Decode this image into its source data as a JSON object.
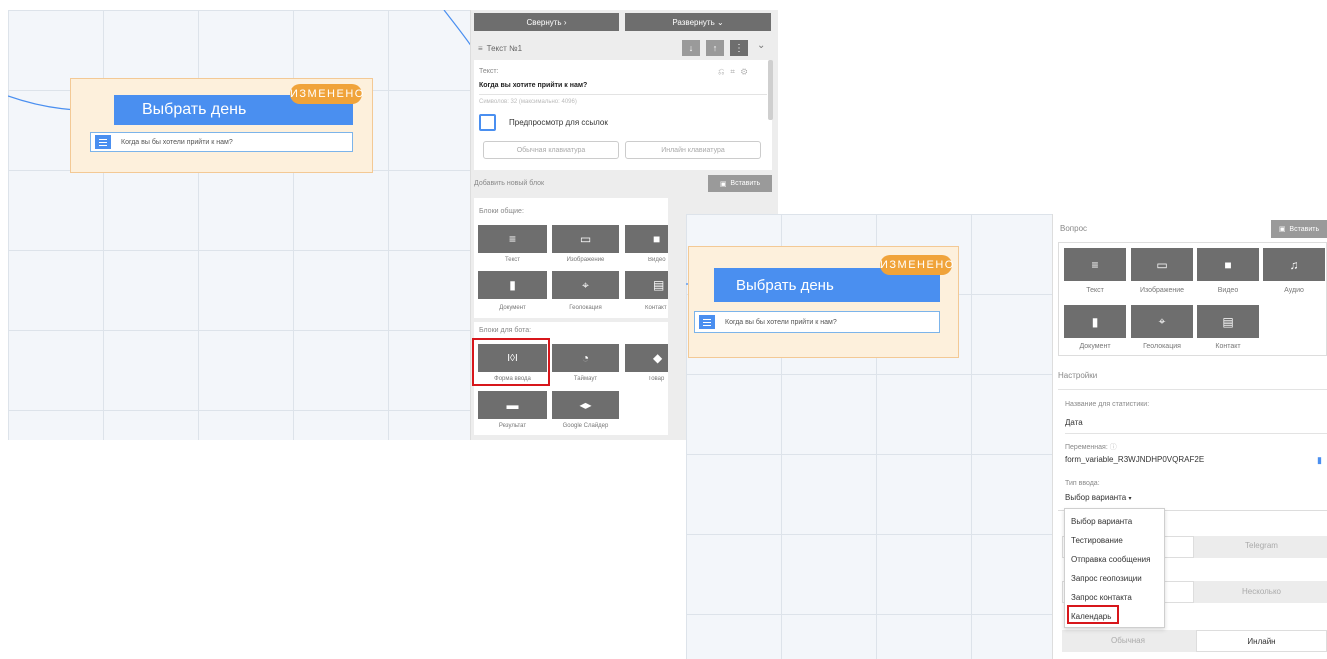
{
  "left": {
    "node": {
      "badge": "ИЗМЕНЕНО",
      "title": "Выбрать день",
      "row_text": "Когда вы бы хотели прийти к нам?"
    },
    "panel": {
      "collapse_label": "Свернуть",
      "expand_label": "Развернуть",
      "block_title": "Текст №1",
      "text_label": "Текст:",
      "text_value": "Когда вы хотите прийти к нам?",
      "symbols_info": "Символов: 32 (максимально: 4096)",
      "preview_label": "Предпросмотр для ссылок",
      "keyboard_normal": "Обычная клавиатура",
      "keyboard_inline": "Инлайн клавиатура",
      "add_block_label": "Добавить новый блок",
      "insert_label": "Вставить",
      "common_blocks_label": "Блоки общие:",
      "common_blocks": [
        "Текст",
        "Изображение",
        "Видео",
        "Документ",
        "Геолокация",
        "Контакт"
      ],
      "bot_blocks_label": "Блоки для бота:",
      "bot_blocks": [
        "Форма ввода",
        "Таймаут",
        "Товар",
        "Результат",
        "Google Слайдер"
      ]
    }
  },
  "right": {
    "node": {
      "badge": "ИЗМЕНЕНО",
      "title": "Выбрать день",
      "row_text": "Когда вы бы хотели прийти к нам?"
    },
    "panel": {
      "question_label": "Вопрос",
      "insert_label": "Вставить",
      "blocks": [
        "Текст",
        "Изображение",
        "Видео",
        "Аудио",
        "Документ",
        "Геолокация",
        "Контакт"
      ],
      "settings_label": "Настройки",
      "stat_name_label": "Название для статистики:",
      "stat_name_value": "Дата",
      "variable_label": "Переменная:",
      "variable_value": "form_variable_R3WJNDHP0VQRAF2E",
      "input_type_label": "Тип ввода:",
      "input_type_value": "Выбор варианта",
      "dropdown_options": [
        "Выбор варианта",
        "Тестирование",
        "Отправка сообщения",
        "Запрос геопозиции",
        "Запрос контакта",
        "Календарь"
      ],
      "telegram_label": "Telegram",
      "multiple_label": "Несколько",
      "normal_label": "Обычная",
      "inline_label": "Инлайн"
    }
  },
  "colors": {
    "accent": "#4a8ff0",
    "badge": "#f0a33a",
    "highlight": "#d7161b",
    "node_bg": "#fdf0dc"
  }
}
